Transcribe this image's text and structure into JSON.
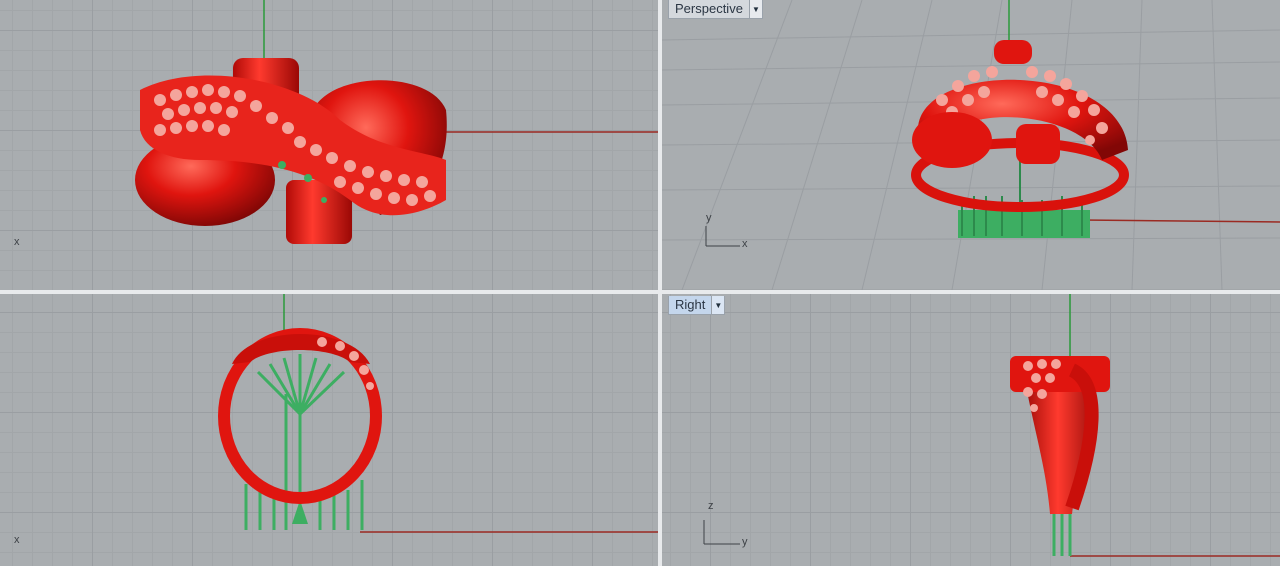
{
  "viewports": {
    "top": {
      "axis_labels": {
        "x": "x"
      }
    },
    "perspective": {
      "title": "Perspective",
      "menu_icon": "chevron-down-icon",
      "axis_labels": {
        "x": "x",
        "y": "y"
      }
    },
    "front": {
      "axis_labels": {
        "x": "x"
      }
    },
    "right": {
      "title": "Right",
      "menu_icon": "chevron-down-icon",
      "axis_labels": {
        "z": "z",
        "y": "y"
      }
    }
  },
  "colors": {
    "model_red": "#e0150f",
    "support_green": "#3dae62",
    "x_axis": "#9b2a22",
    "y_axis": "#2a9a3a",
    "grid_bg": "#a9adb0",
    "tab_bg": "#d4d8dd",
    "tab_active_bg": "#c4d6ec"
  }
}
